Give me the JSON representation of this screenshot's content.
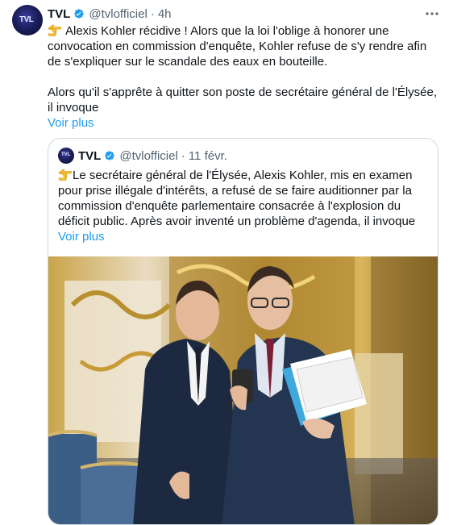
{
  "tweet": {
    "author_name": "TVL",
    "handle": "@tvlofficiel",
    "separator": "·",
    "time": "4h",
    "paragraph1": "Alexis Kohler récidive ! Alors que la loi l'oblige à honorer une convocation en commission d'enquête, Kohler refuse de s'y rendre afin de s'expliquer sur le scandale des eaux en bouteille.",
    "paragraph2": "Alors qu'il s'apprête à quitter son poste de secrétaire général de l'Élysée, il invoque",
    "show_more": "Voir plus"
  },
  "quote": {
    "author_name": "TVL",
    "handle": "@tvlofficiel",
    "separator": "·",
    "time": "11 févr.",
    "text": "Le secrétaire général de l'Élysée, Alexis Kohler, mis en examen pour prise illégale d'intérêts, a refusé de se faire auditionner par la commission d'enquête parlementaire consacrée à l'explosion du déficit public. Après avoir inventé un problème d'agenda, il invoque",
    "show_more": "Voir plus"
  },
  "avatar_label": "TVL",
  "icons": {
    "verified": "verified-badge-icon",
    "more": "more-options-icon",
    "pointing": "pointing-hand-emoji"
  },
  "colors": {
    "link": "#1d9bf0",
    "verified": "#1d9bf0",
    "muted": "#536471",
    "border": "#cfd9de",
    "text": "#0f1419"
  }
}
